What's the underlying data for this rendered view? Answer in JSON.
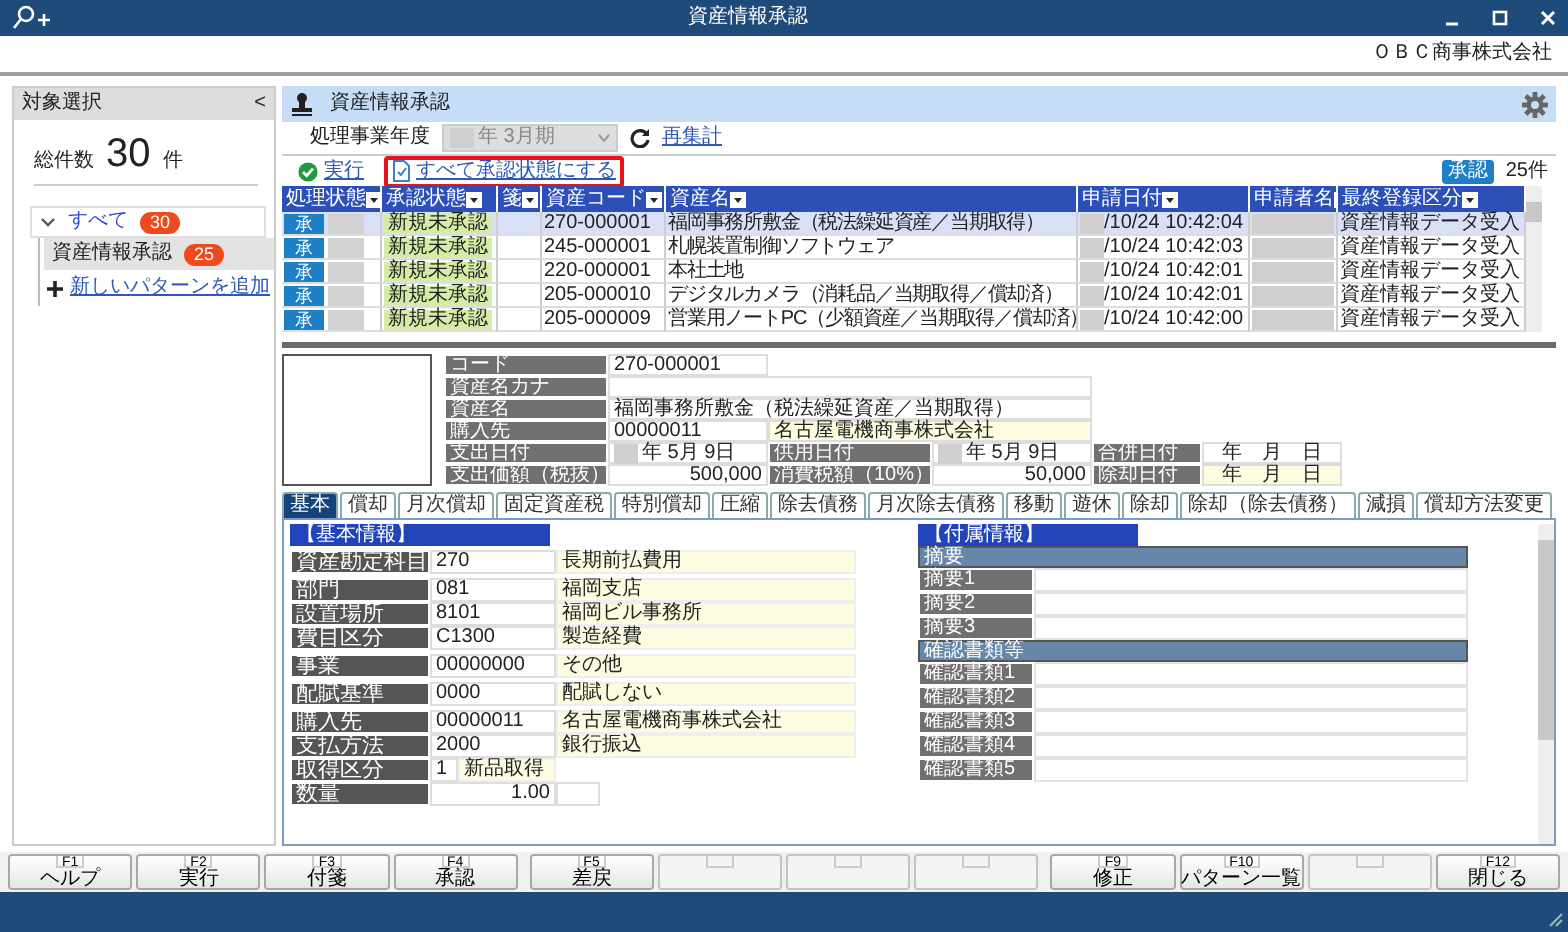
{
  "window": {
    "title": "資産情報承認",
    "company": "ＯＢＣ商事株式会社"
  },
  "sidebar": {
    "title": "対象選択",
    "collapse_glyph": "<",
    "total_label": "総件数",
    "total": "30",
    "total_unit": "件",
    "tree": [
      {
        "label": "すべて",
        "count": "30",
        "expanded": true,
        "selected": false,
        "children": [
          {
            "label": "資産情報承認",
            "count": "25",
            "selected": true
          }
        ]
      }
    ],
    "add_pattern": "新しいパターンを追加"
  },
  "panel": {
    "title": "資産情報承認"
  },
  "filter": {
    "label": "処理事業年度",
    "value": "年 3月期",
    "disabled": true,
    "link": "再集計"
  },
  "actions": [
    {
      "kind": "execute",
      "label": "実行",
      "highlighted": false
    },
    {
      "kind": "approve_all",
      "label": "すべて承認状態にする",
      "highlighted": true
    }
  ],
  "summary": {
    "badge": "承認",
    "count": "25件"
  },
  "table": {
    "columns": [
      "処理状態",
      "承認状態",
      "箋",
      "資産コード",
      "資産名",
      "申請日付",
      "申請者名",
      "最終登録区分"
    ],
    "rows": [
      {
        "action": "承",
        "status": "新規未承認",
        "code": "270-000001",
        "name": "福岡事務所敷金（税法繰延資産／当期取得）",
        "date": "/10/24 10:42:04",
        "registration": "資産情報データ受入",
        "selected": true
      },
      {
        "action": "承",
        "status": "新規未承認",
        "code": "245-000001",
        "name": "札幌装置制御ソフトウェア",
        "date": "/10/24 10:42:03",
        "registration": "資産情報データ受入",
        "selected": false
      },
      {
        "action": "承",
        "status": "新規未承認",
        "code": "220-000001",
        "name": "本社土地",
        "date": "/10/24 10:42:01",
        "registration": "資産情報データ受入",
        "selected": false
      },
      {
        "action": "承",
        "status": "新規未承認",
        "code": "205-000010",
        "name": "デジタルカメラ（消耗品／当期取得／償却済）",
        "date": "/10/24 10:42:01",
        "registration": "資産情報データ受入",
        "selected": false
      },
      {
        "action": "承",
        "status": "新規未承認",
        "code": "205-000009",
        "name": "営業用ノートPC（少額資産／当期取得／償却済）",
        "date": "/10/24 10:42:00",
        "registration": "資産情報データ受入",
        "selected": false
      }
    ]
  },
  "detail": {
    "rows": [
      [
        {
          "kind": "label",
          "text": "コード"
        },
        {
          "kind": "text",
          "text": "270-000001"
        }
      ],
      [
        {
          "kind": "label",
          "text": "資産名カナ"
        },
        {
          "kind": "long"
        }
      ],
      [
        {
          "kind": "label",
          "text": "資産名"
        },
        {
          "kind": "long",
          "text": "福岡事務所敷金（税法繰延資産／当期取得）"
        }
      ],
      [
        {
          "kind": "label",
          "text": "購入先"
        },
        {
          "kind": "text",
          "text": "00000011"
        },
        {
          "kind": "name",
          "text": "名古屋電機商事株式会社"
        }
      ],
      [
        {
          "kind": "label",
          "text": "支出日付"
        },
        {
          "kind": "date",
          "text": "年 5月 9日",
          "masked": true,
          "readonly": false
        },
        {
          "kind": "label",
          "text": "供用日付"
        },
        {
          "kind": "date",
          "text": "年 5月 9日",
          "masked": true,
          "readonly": false
        },
        {
          "kind": "label",
          "text": "合併日付"
        },
        {
          "kind": "date",
          "text": "年　月　日",
          "masked": false,
          "readonly": false
        }
      ],
      [
        {
          "kind": "label",
          "text": "支出価額（税抜）"
        },
        {
          "kind": "amount",
          "text": "500,000"
        },
        {
          "kind": "label",
          "text": "消費税額（10%）"
        },
        {
          "kind": "amount",
          "text": "50,000"
        },
        {
          "kind": "label",
          "text": "除却日付"
        },
        {
          "kind": "date",
          "text": "年　月　日",
          "masked": false,
          "readonly": true
        }
      ]
    ]
  },
  "tabs": [
    {
      "label": "基本",
      "selected": true
    },
    {
      "label": "償却",
      "selected": false
    },
    {
      "label": "月次償却",
      "selected": false
    },
    {
      "label": "固定資産税",
      "selected": false
    },
    {
      "label": "特別償却",
      "selected": false
    },
    {
      "label": "圧縮",
      "selected": false
    },
    {
      "label": "除去債務",
      "selected": false
    },
    {
      "label": "月次除去債務",
      "selected": false
    },
    {
      "label": "移動",
      "selected": false
    },
    {
      "label": "遊休",
      "selected": false
    },
    {
      "label": "除却",
      "selected": false
    },
    {
      "label": "除却（除去債務）",
      "selected": false
    },
    {
      "label": "減損",
      "selected": false
    },
    {
      "label": "償却方法変更",
      "selected": false
    }
  ],
  "basic_info": {
    "title": "【基本情報】",
    "groups": [
      [
        {
          "kind": "coded",
          "label": "資産勘定科目",
          "code": "270",
          "name": "長期前払費用"
        }
      ],
      [
        {
          "kind": "coded",
          "label": "部門",
          "code": "081",
          "name": "福岡支店"
        },
        {
          "kind": "coded",
          "label": "設置場所",
          "code": "8101",
          "name": "福岡ビル事務所"
        },
        {
          "kind": "coded",
          "label": "費目区分",
          "code": "C1300",
          "name": "製造経費"
        }
      ],
      [
        {
          "kind": "coded",
          "label": "事業",
          "code": "00000000",
          "name": "その他"
        }
      ],
      [
        {
          "kind": "coded",
          "label": "配賦基準",
          "code": "0000",
          "name": "配賦しない"
        }
      ],
      [
        {
          "kind": "coded",
          "label": "購入先",
          "code": "00000011",
          "name": "名古屋電機商事株式会社"
        },
        {
          "kind": "coded",
          "label": "支払方法",
          "code": "2000",
          "name": "銀行振込"
        },
        {
          "kind": "option",
          "label": "取得区分",
          "code": "1",
          "name": "新品取得"
        },
        {
          "kind": "quantity",
          "label": "数量",
          "code": "1.00"
        }
      ]
    ]
  },
  "attached_info": {
    "title": "【付属情報】",
    "sections": [
      {
        "title": "摘要",
        "rows": [
          "摘要1",
          "摘要2",
          "摘要3"
        ]
      },
      {
        "title": "確認書類等",
        "rows": [
          "確認書類1",
          "確認書類2",
          "確認書類3",
          "確認書類4",
          "確認書類5"
        ]
      }
    ]
  },
  "function_keys": [
    [
      {
        "key": "F1",
        "label": "ヘルプ",
        "blank": false
      },
      {
        "key": "F2",
        "label": "実行",
        "blank": false
      },
      {
        "key": "F3",
        "label": "付箋",
        "blank": false
      },
      {
        "key": "F4",
        "label": "承認",
        "blank": false
      }
    ],
    [
      {
        "key": "F5",
        "label": "差戻",
        "blank": false
      },
      {
        "blank": true
      },
      {
        "blank": true
      },
      {
        "blank": true
      }
    ],
    [
      {
        "key": "F9",
        "label": "修正",
        "blank": false
      },
      {
        "key": "F10",
        "label": "パターン一覧",
        "blank": false
      },
      {
        "blank": true
      },
      {
        "key": "F12",
        "label": "閉じる",
        "blank": false
      }
    ]
  ]
}
